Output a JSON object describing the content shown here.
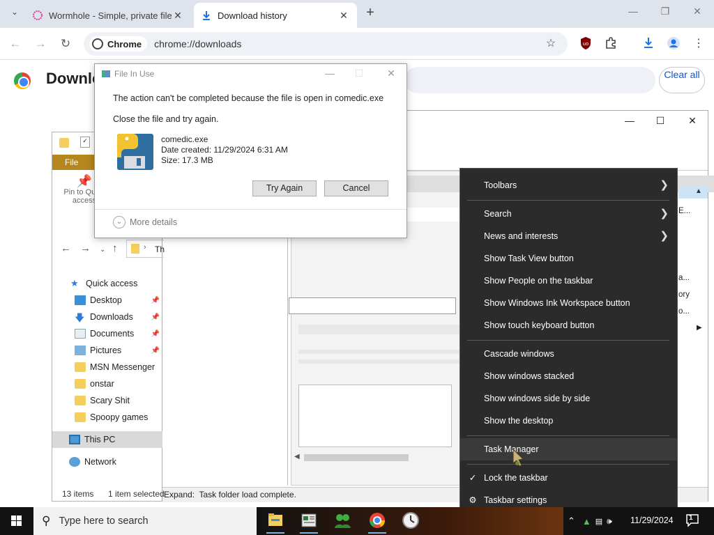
{
  "browser": {
    "tabs": [
      {
        "title": "Wormhole - Simple, private file",
        "icon": "wormhole-icon",
        "active": false
      },
      {
        "title": "Download history",
        "icon": "download-icon",
        "active": true
      }
    ],
    "omnibox": {
      "chip": "Chrome",
      "url": "chrome://downloads"
    },
    "new_tab": "+"
  },
  "downloads_page": {
    "title": "Downlo",
    "clear_all": "Clear all"
  },
  "task_window": {
    "status_text": "Expand:  Task folder load complete.",
    "right_fragments": [
      "E...",
      "a...",
      "ory",
      "o..."
    ]
  },
  "explorer": {
    "ribbon_tab": "File",
    "pin_label": "Pin to Quick access",
    "path_fragment": "Th",
    "tree": [
      {
        "label": "Quick access",
        "icon": "star-icon"
      },
      {
        "label": "Desktop",
        "icon": "desktop-folder-icon",
        "pinned": true
      },
      {
        "label": "Downloads",
        "icon": "downloads-folder-icon",
        "pinned": true
      },
      {
        "label": "Documents",
        "icon": "documents-folder-icon",
        "pinned": true
      },
      {
        "label": "Pictures",
        "icon": "pictures-folder-icon",
        "pinned": true
      },
      {
        "label": "MSN Messenger",
        "icon": "folder-icon"
      },
      {
        "label": "onstar",
        "icon": "folder-icon"
      },
      {
        "label": "Scary Shit",
        "icon": "folder-icon"
      },
      {
        "label": "Spoopy games",
        "icon": "folder-icon"
      },
      {
        "label": "This PC",
        "icon": "computer-icon"
      },
      {
        "label": "Network",
        "icon": "network-icon"
      }
    ],
    "status_items": "13 items",
    "status_selected": "1 item selected"
  },
  "dialog": {
    "title": "File In Use",
    "message": "The action can't be completed because the file is open in comedic.exe",
    "instruction": "Close the file and try again.",
    "file_name": "comedic.exe",
    "date_created": "Date created: 11/29/2024 6:31 AM",
    "size": "Size: 17.3 MB",
    "try_again": "Try Again",
    "cancel": "Cancel",
    "more_details": "More details"
  },
  "context_menu": {
    "items": [
      {
        "label": "Toolbars",
        "submenu": true
      },
      {
        "label": "Search",
        "submenu": true
      },
      {
        "label": "News and interests",
        "submenu": true
      },
      {
        "label": "Show Task View button"
      },
      {
        "label": "Show People on the taskbar"
      },
      {
        "label": "Show Windows Ink Workspace button"
      },
      {
        "label": "Show touch keyboard button"
      },
      {
        "label": "Cascade windows"
      },
      {
        "label": "Show windows stacked"
      },
      {
        "label": "Show windows side by side"
      },
      {
        "label": "Show the desktop"
      },
      {
        "label": "Task Manager"
      },
      {
        "label": "Lock the taskbar",
        "checked": true
      },
      {
        "label": "Taskbar settings",
        "icon": "gear-icon"
      }
    ]
  },
  "taskbar": {
    "search_placeholder": "Type here to search",
    "clock_date": "11/29/2024",
    "notification_count": "1"
  }
}
